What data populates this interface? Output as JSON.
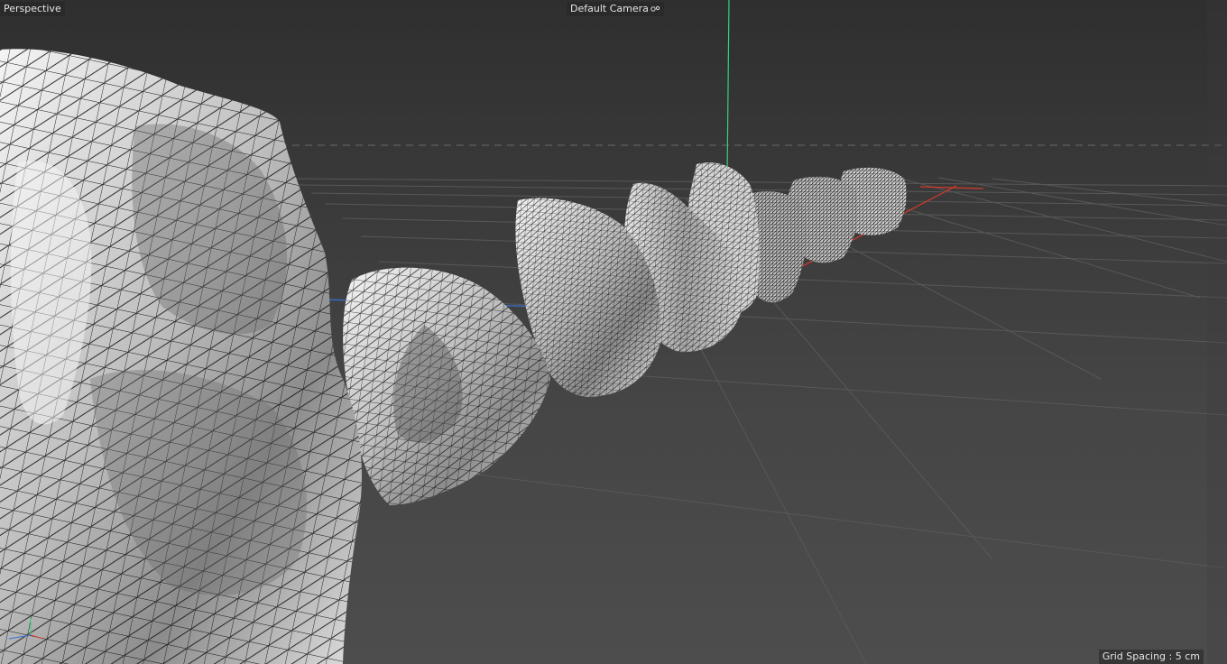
{
  "viewport": {
    "view_mode": "Perspective",
    "camera": "Default Camera",
    "camera_icon": "camera-icon",
    "grid_spacing": "Grid Spacing : 5 cm"
  },
  "colors": {
    "background_top": "#2f2f2f",
    "background_bottom": "#4d4d4d",
    "grid_line": "#5a5a5a",
    "axis_y": "#31d27a",
    "axis_x": "#d43a2a",
    "axis_z": "#3a6fd4",
    "mesh_light": "#f2f2f2",
    "mesh_dark": "#7a7a7a",
    "wire": "#111111"
  },
  "scene": {
    "object_count": 9,
    "display_mode": "gouraud-shaded-wireframe"
  }
}
